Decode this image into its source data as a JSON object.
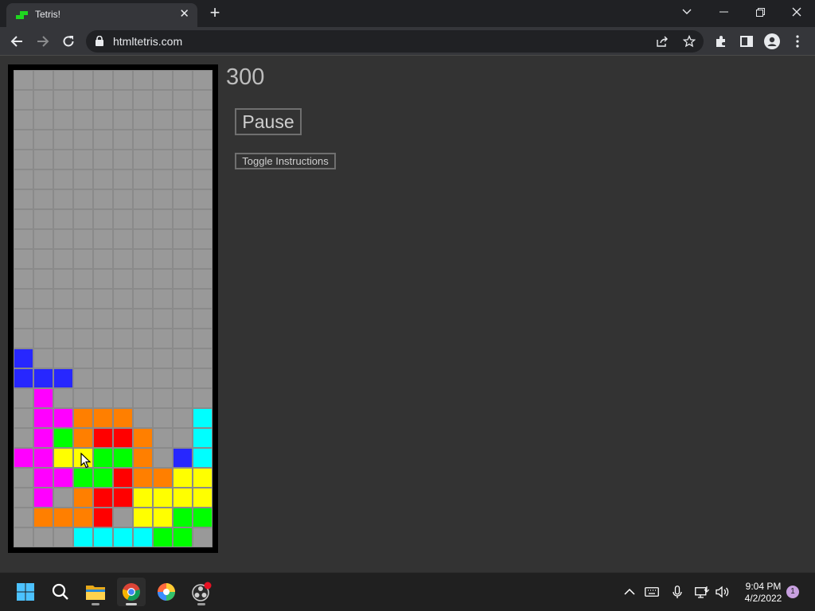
{
  "browser": {
    "tab_title": "Tetris!",
    "url": "htmltetris.com"
  },
  "game": {
    "score": "300",
    "pause_label": "Pause",
    "instructions_label": "Toggle Instructions",
    "columns": 10,
    "rows": 24,
    "empty_color": "#999999",
    "palette": {
      "B": "#2727ff",
      "M": "#ff00ff",
      "O": "#ff7f00",
      "C": "#00ffff",
      "G": "#00ff00",
      "R": "#ff0000",
      "Y": "#ffff00"
    },
    "board": [
      "..........",
      "..........",
      "..........",
      "..........",
      "..........",
      "..........",
      "..........",
      "..........",
      "..........",
      "..........",
      "..........",
      "..........",
      "..........",
      "..........",
      "B.........",
      "BBB.......",
      ".M........",
      ".MMOOO...C",
      ".MGORRO..C",
      "MMYYGGO.BC",
      ".MMGGROOYY",
      ".M.ORRYYYY",
      ".OOOR.YYGG",
      "...CCCCGG."
    ]
  },
  "taskbar": {
    "time": "9:04 PM",
    "date": "4/2/2022",
    "notification_count": "1"
  }
}
